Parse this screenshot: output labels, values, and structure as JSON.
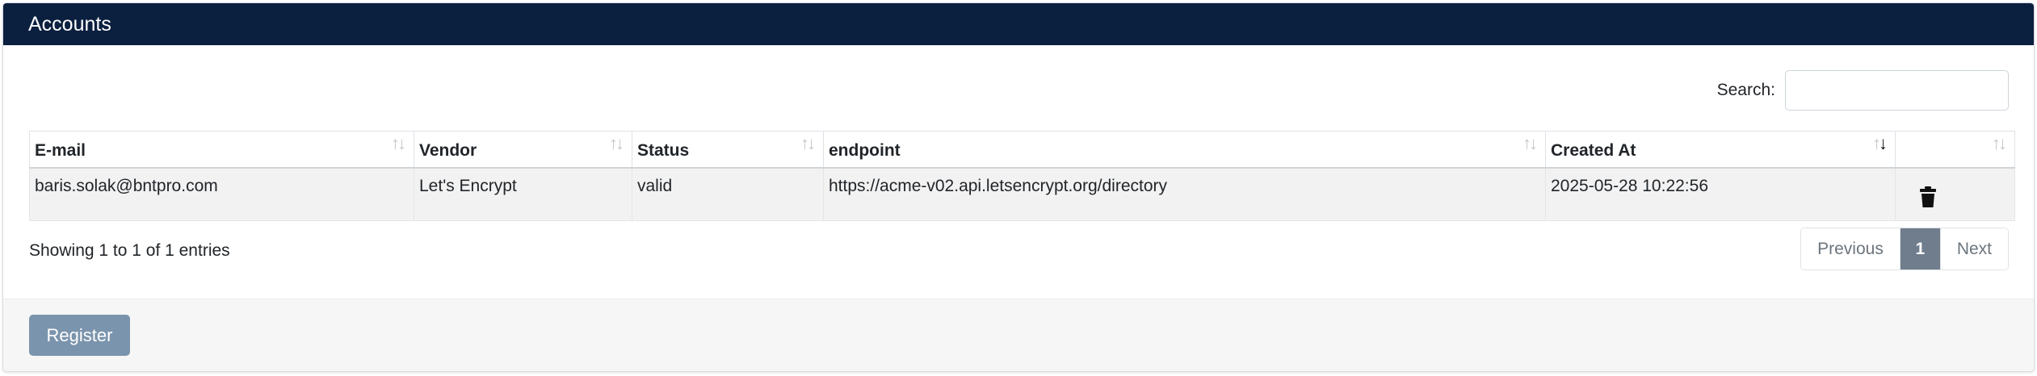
{
  "header": {
    "title": "Accounts"
  },
  "search": {
    "label": "Search:",
    "value": ""
  },
  "table": {
    "columns": [
      {
        "key": "email",
        "label": "E-mail"
      },
      {
        "key": "vendor",
        "label": "Vendor"
      },
      {
        "key": "status",
        "label": "Status"
      },
      {
        "key": "endpoint",
        "label": "endpoint"
      },
      {
        "key": "created_at",
        "label": "Created At",
        "sorted": "descending"
      },
      {
        "key": "actions",
        "label": ""
      }
    ],
    "rows": [
      {
        "email": "baris.solak@bntpro.com",
        "vendor": "Let's Encrypt",
        "status": "valid",
        "endpoint": "https://acme-v02.api.letsencrypt.org/directory",
        "created_at": "2025-05-28 10:22:56",
        "action_icon": "trash-icon"
      }
    ]
  },
  "info": {
    "text": "Showing 1 to 1 of 1 entries"
  },
  "pagination": {
    "previous": "Previous",
    "current": "1",
    "next": "Next"
  },
  "footer": {
    "register_label": "Register"
  },
  "colors": {
    "header_bg": "#0b1f3f",
    "register_bg": "#7b94ad",
    "active_page_bg": "#707d8c"
  }
}
